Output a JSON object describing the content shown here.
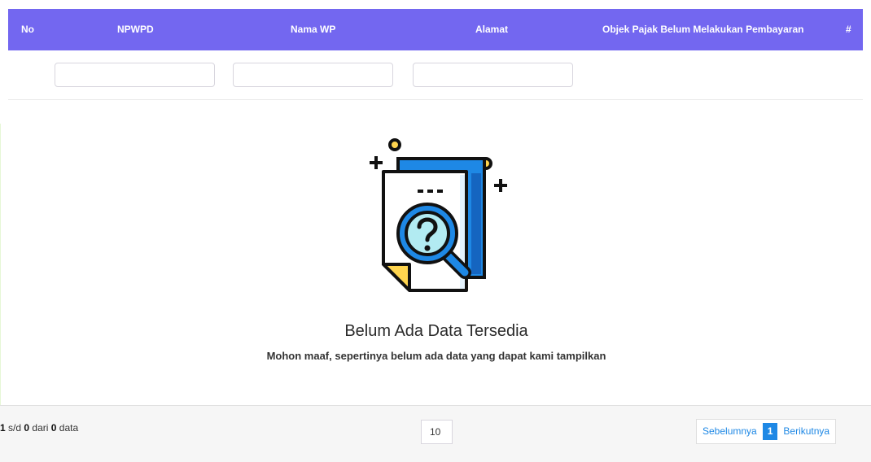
{
  "table": {
    "headers": {
      "no": "No",
      "npwpd": "NPWPD",
      "nama_wp": "Nama WP",
      "alamat": "Alamat",
      "objek_pajak": "Objek Pajak Belum Melakukan Pembayaran",
      "actions": "#"
    },
    "header_color": "#7367f0",
    "filters": {
      "npwpd": "",
      "nama_wp": "",
      "alamat": ""
    }
  },
  "empty_state": {
    "icon": "document-search-question-icon",
    "title": "Belum Ada Data Tersedia",
    "subtitle": "Mohon maaf, sepertinya belum ada data yang dapat kami tampilkan"
  },
  "footer": {
    "info": {
      "from": "1",
      "sep1": " s/d ",
      "to": "0",
      "sep2": " dari ",
      "total": "0",
      "suffix": " data"
    },
    "per_page": "10",
    "pagination": {
      "prev": "Sebelumnya",
      "current": "1",
      "next": "Berikutnya"
    },
    "accent_color": "#1e88e5"
  }
}
